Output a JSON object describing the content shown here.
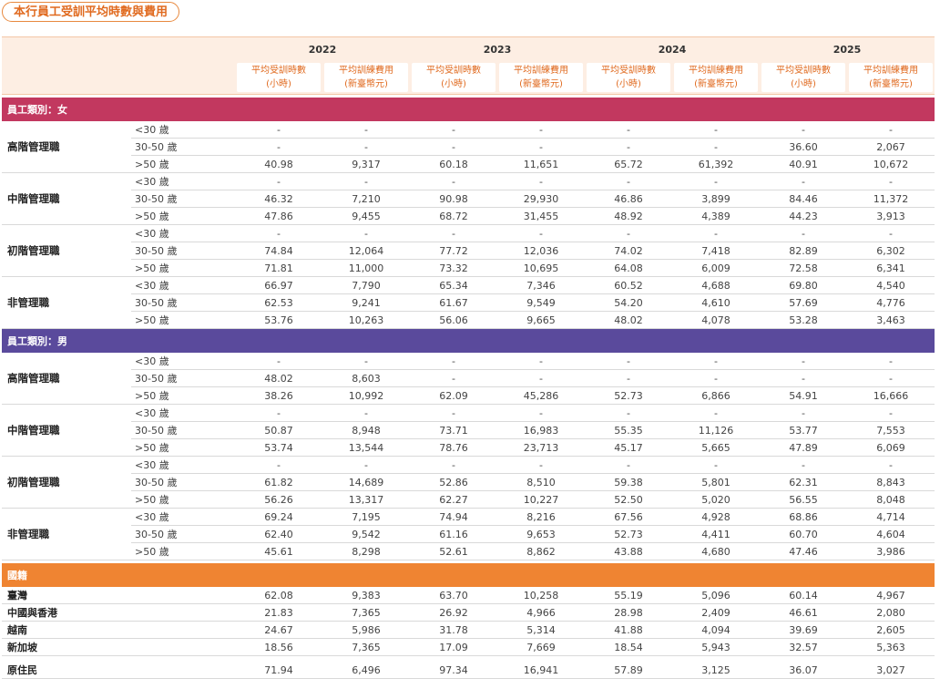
{
  "title": "本行員工受訓平均時數與費用",
  "years": [
    "2022",
    "2023",
    "2024",
    "2025"
  ],
  "sub_labels": {
    "hours_1": "平均受訓時數",
    "hours_2": "(小時)",
    "cost_1": "平均訓練費用",
    "cost_2": "(新臺幣元)"
  },
  "sections": [
    {
      "label": "員工類別：女",
      "groups": [
        {
          "name": "高階管理職",
          "rows": [
            {
              "age": "<30 歲",
              "values": [
                "-",
                "-",
                "-",
                "-",
                "-",
                "-",
                "-",
                "-"
              ]
            },
            {
              "age": "30-50 歲",
              "values": [
                "-",
                "-",
                "-",
                "-",
                "-",
                "-",
                "36.60",
                "2,067"
              ]
            },
            {
              "age": ">50 歲",
              "values": [
                "40.98",
                "9,317",
                "60.18",
                "11,651",
                "65.72",
                "61,392",
                "40.91",
                "10,672"
              ]
            }
          ]
        },
        {
          "name": "中階管理職",
          "rows": [
            {
              "age": "<30 歲",
              "values": [
                "-",
                "-",
                "-",
                "-",
                "-",
                "-",
                "-",
                "-"
              ]
            },
            {
              "age": "30-50 歲",
              "values": [
                "46.32",
                "7,210",
                "90.98",
                "29,930",
                "46.86",
                "3,899",
                "84.46",
                "11,372"
              ]
            },
            {
              "age": ">50 歲",
              "values": [
                "47.86",
                "9,455",
                "68.72",
                "31,455",
                "48.92",
                "4,389",
                "44.23",
                "3,913"
              ]
            }
          ]
        },
        {
          "name": "初階管理職",
          "rows": [
            {
              "age": "<30 歲",
              "values": [
                "-",
                "-",
                "-",
                "-",
                "-",
                "-",
                "-",
                "-"
              ]
            },
            {
              "age": "30-50 歲",
              "values": [
                "74.84",
                "12,064",
                "77.72",
                "12,036",
                "74.02",
                "7,418",
                "82.89",
                "6,302"
              ]
            },
            {
              "age": ">50 歲",
              "values": [
                "71.81",
                "11,000",
                "73.32",
                "10,695",
                "64.08",
                "6,009",
                "72.58",
                "6,341"
              ]
            }
          ]
        },
        {
          "name": "非管理職",
          "rows": [
            {
              "age": "<30 歲",
              "values": [
                "66.97",
                "7,790",
                "65.34",
                "7,346",
                "60.52",
                "4,688",
                "69.80",
                "4,540"
              ]
            },
            {
              "age": "30-50 歲",
              "values": [
                "62.53",
                "9,241",
                "61.67",
                "9,549",
                "54.20",
                "4,610",
                "57.69",
                "4,776"
              ]
            },
            {
              "age": ">50 歲",
              "values": [
                "53.76",
                "10,263",
                "56.06",
                "9,665",
                "48.02",
                "4,078",
                "53.28",
                "3,463"
              ]
            }
          ]
        }
      ]
    },
    {
      "label": "員工類別：男",
      "groups": [
        {
          "name": "高階管理職",
          "rows": [
            {
              "age": "<30 歲",
              "values": [
                "-",
                "-",
                "-",
                "-",
                "-",
                "-",
                "-",
                "-"
              ]
            },
            {
              "age": "30-50 歲",
              "values": [
                "48.02",
                "8,603",
                "-",
                "-",
                "-",
                "-",
                "-",
                "-"
              ]
            },
            {
              "age": ">50 歲",
              "values": [
                "38.26",
                "10,992",
                "62.09",
                "45,286",
                "52.73",
                "6,866",
                "54.91",
                "16,666"
              ]
            }
          ]
        },
        {
          "name": "中階管理職",
          "rows": [
            {
              "age": "<30 歲",
              "values": [
                "-",
                "-",
                "-",
                "-",
                "-",
                "-",
                "-",
                "-"
              ]
            },
            {
              "age": "30-50 歲",
              "values": [
                "50.87",
                "8,948",
                "73.71",
                "16,983",
                "55.35",
                "11,126",
                "53.77",
                "7,553"
              ]
            },
            {
              "age": ">50 歲",
              "values": [
                "53.74",
                "13,544",
                "78.76",
                "23,713",
                "45.17",
                "5,665",
                "47.89",
                "6,069"
              ]
            }
          ]
        },
        {
          "name": "初階管理職",
          "rows": [
            {
              "age": "<30 歲",
              "values": [
                "-",
                "-",
                "-",
                "-",
                "-",
                "-",
                "-",
                "-"
              ]
            },
            {
              "age": "30-50 歲",
              "values": [
                "61.82",
                "14,689",
                "52.86",
                "8,510",
                "59.38",
                "5,801",
                "62.31",
                "8,843"
              ]
            },
            {
              "age": ">50 歲",
              "values": [
                "56.26",
                "13,317",
                "62.27",
                "10,227",
                "52.50",
                "5,020",
                "56.55",
                "8,048"
              ]
            }
          ]
        },
        {
          "name": "非管理職",
          "rows": [
            {
              "age": "<30 歲",
              "values": [
                "69.24",
                "7,195",
                "74.94",
                "8,216",
                "67.56",
                "4,928",
                "68.86",
                "4,714"
              ]
            },
            {
              "age": "30-50 歲",
              "values": [
                "62.40",
                "9,542",
                "61.16",
                "9,653",
                "52.73",
                "4,411",
                "60.70",
                "4,604"
              ]
            },
            {
              "age": ">50 歲",
              "values": [
                "45.61",
                "8,298",
                "52.61",
                "8,862",
                "43.88",
                "4,680",
                "47.46",
                "3,986"
              ]
            }
          ]
        }
      ]
    }
  ],
  "nationality": {
    "label": "國籍",
    "rows": [
      {
        "name": "臺灣",
        "values": [
          "62.08",
          "9,383",
          "63.70",
          "10,258",
          "55.19",
          "5,096",
          "60.14",
          "4,967"
        ]
      },
      {
        "name": "中國與香港",
        "values": [
          "21.83",
          "7,365",
          "26.92",
          "4,966",
          "28.98",
          "2,409",
          "46.61",
          "2,080"
        ]
      },
      {
        "name": "越南",
        "values": [
          "24.67",
          "5,986",
          "31.78",
          "5,314",
          "41.88",
          "4,094",
          "39.69",
          "2,605"
        ]
      },
      {
        "name": "新加坡",
        "values": [
          "18.56",
          "7,365",
          "17.09",
          "7,669",
          "18.54",
          "5,943",
          "32.57",
          "5,363"
        ]
      }
    ],
    "extra": {
      "name": "原住民",
      "values": [
        "71.94",
        "6,496",
        "97.34",
        "16,941",
        "57.89",
        "3,125",
        "36.07",
        "3,027"
      ]
    }
  },
  "colors": {
    "female_band": "#c2385f",
    "male_band": "#5a4a9c",
    "nationality_band": "#ef8432",
    "accent": "#e06a1f"
  }
}
